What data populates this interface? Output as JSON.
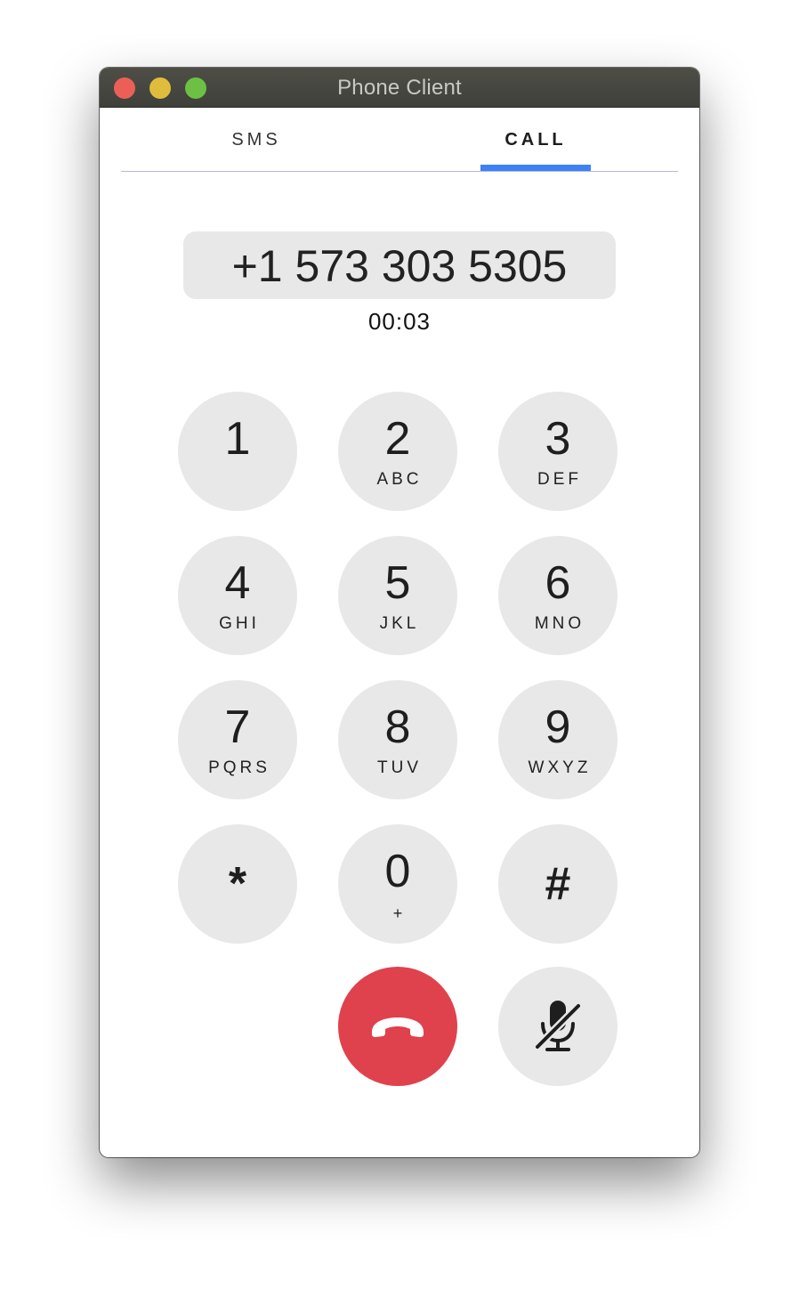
{
  "window": {
    "title": "Phone Client"
  },
  "tabs": [
    {
      "label": "SMS",
      "active": false
    },
    {
      "label": "CALL",
      "active": true
    }
  ],
  "call": {
    "number": "+1 573 303 5305",
    "timer": "00:03"
  },
  "keypad": [
    {
      "digit": "1",
      "letters": ""
    },
    {
      "digit": "2",
      "letters": "ABC"
    },
    {
      "digit": "3",
      "letters": "DEF"
    },
    {
      "digit": "4",
      "letters": "GHI"
    },
    {
      "digit": "5",
      "letters": "JKL"
    },
    {
      "digit": "6",
      "letters": "MNO"
    },
    {
      "digit": "7",
      "letters": "PQRS"
    },
    {
      "digit": "8",
      "letters": "TUV"
    },
    {
      "digit": "9",
      "letters": "WXYZ"
    },
    {
      "digit": "*",
      "letters": ""
    },
    {
      "digit": "0",
      "letters": "+"
    },
    {
      "digit": "#",
      "letters": ""
    }
  ],
  "actions": {
    "hangup_icon": "phone-hangup-icon",
    "mute_icon": "microphone-muted-icon"
  },
  "colors": {
    "accent": "#3b82f6",
    "hangup": "#df424d",
    "key_background": "#e8e8e8"
  }
}
